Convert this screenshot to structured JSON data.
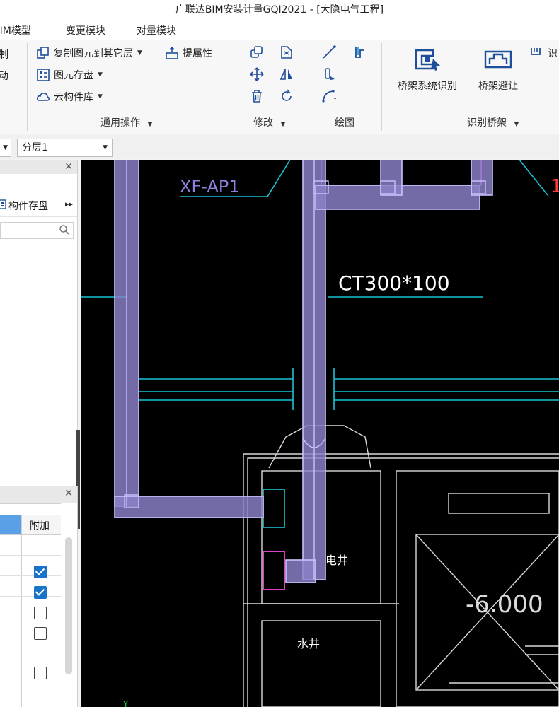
{
  "window": {
    "title": "广联达BIM安装计量GQI2021 - [大隐电气工程]"
  },
  "menu": {
    "tab_bim": "BIM模型",
    "tab_change": "变更模块",
    "tab_compare": "对量模块"
  },
  "ribbon": {
    "left_partial_1": "制",
    "left_partial_2": "动",
    "copy_to_layer": "复制图元到其它层",
    "extract_attr": "提属性",
    "element_storage": "图元存盘",
    "cloud_library": "云构件库",
    "group_general": "通用操作",
    "group_modify": "修改",
    "group_draw": "绘图",
    "tray_identify": "桥架系统识别",
    "tray_avoid": "桥架避让",
    "partial_identify": "识",
    "group_tray": "识别桥架"
  },
  "layer": {
    "selector_value": "分层1"
  },
  "left_panel": {
    "component_storage": "构件存盘",
    "column_extra": "附加",
    "checkboxes": [
      true,
      true,
      false,
      false,
      false
    ]
  },
  "canvas": {
    "label_xf": "XF-AP1",
    "label_tray": "CT300*100",
    "label_elec_well": "电井",
    "label_water_well": "水井",
    "label_elevation": "-6.000",
    "label_partial_red": "1"
  },
  "colors": {
    "canvas_bg": "#000000",
    "tray_fill": "#8b82c9",
    "tray_edge": "#c9c2ff",
    "cyan_line": "#19c3d6",
    "magenta": "#e040c8",
    "wall_line": "#d9d9d9",
    "checkbox_on": "#1a73c8"
  }
}
